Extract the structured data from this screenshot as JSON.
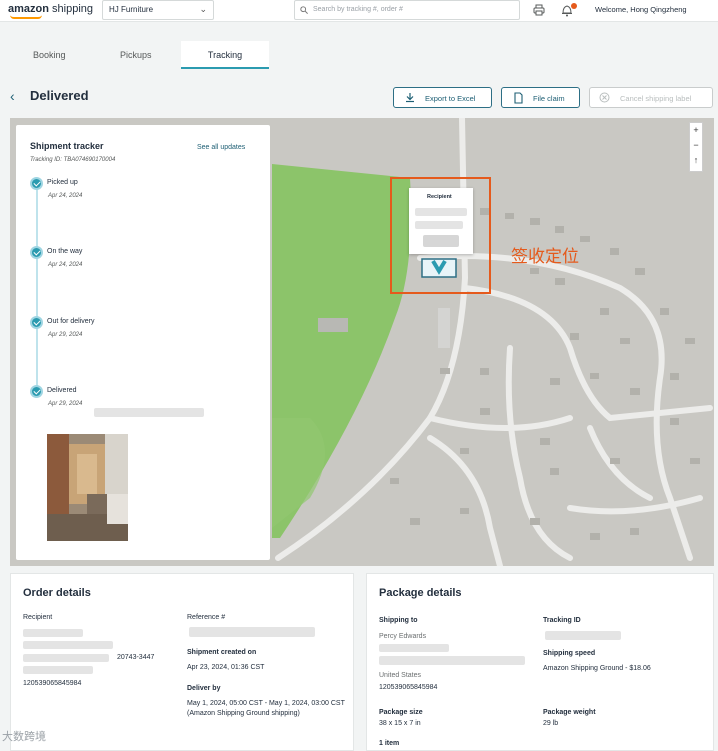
{
  "header": {
    "logo_text": "amazon",
    "logo_suffix": "shipping",
    "company": "HJ Furniture",
    "search_placeholder": "Search by tracking #, order #",
    "welcome": "Welcome, Hong Qingzheng"
  },
  "tabs": [
    "Booking",
    "Pickups",
    "Tracking"
  ],
  "active_tab": "Tracking",
  "page": {
    "title": "Delivered",
    "buttons": {
      "export": "Export to Excel",
      "claim": "File claim",
      "cancel": "Cancel shipping label"
    }
  },
  "tracker": {
    "title": "Shipment tracker",
    "tracking_id": "Tracking ID: TBA074690170004",
    "see_all": "See all updates",
    "steps": [
      {
        "label": "Picked up",
        "date": "Apr 24, 2024"
      },
      {
        "label": "On the way",
        "date": "Apr 24, 2024"
      },
      {
        "label": "Out for delivery",
        "date": "Apr 29, 2024"
      },
      {
        "label": "Delivered",
        "date": "Apr 29, 2024"
      }
    ]
  },
  "map": {
    "popup_title": "Recipient",
    "annotation": "签收定位"
  },
  "order_details": {
    "title": "Order details",
    "recipient_label": "Recipient",
    "recipient_zip": "20743-3447",
    "recipient_number": "120539065845984",
    "reference_label": "Reference #",
    "created_label": "Shipment created on",
    "created_value": "Apr 23, 2024, 01:36 CST",
    "deliver_label": "Deliver by",
    "deliver_value": "May 1, 2024, 05:00 CST - May 1, 2024, 03:00 CST (Amazon Shipping Ground shipping)"
  },
  "package_details": {
    "title": "Package details",
    "shipping_to_label": "Shipping to",
    "shipping_to_name": "Percy Edwards",
    "shipping_to_country": "United States",
    "shipping_to_number": "120539065845984",
    "tracking_label": "Tracking ID",
    "speed_label": "Shipping speed",
    "speed_value": "Amazon Shipping Ground - $18.06",
    "size_label": "Package size",
    "size_value": "38 x 15 x 7 in",
    "weight_label": "Package weight",
    "weight_value": "29 lb",
    "items": "1 item"
  },
  "watermark": "大数跨境",
  "colors": {
    "accent": "#2b9bb0",
    "annotation": "#e55a1c",
    "park": "#8cc46a",
    "map_base": "#c7c6c2"
  }
}
